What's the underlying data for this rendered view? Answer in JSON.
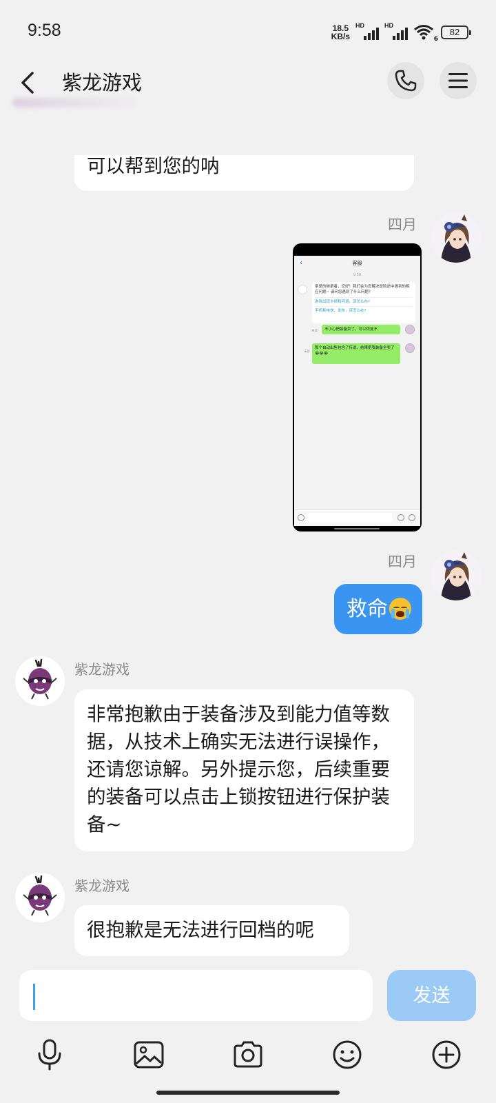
{
  "status": {
    "time": "9:58",
    "net_speed_value": "18.5",
    "net_speed_unit": "KB/s",
    "sim1_label": "HD",
    "sim2_label": "HD",
    "wifi_label": "6",
    "battery": "82"
  },
  "header": {
    "title": "紫龙游戏"
  },
  "messages": {
    "top_partial": "可以帮到您的呐",
    "time_1": "四月",
    "time_2": "四月",
    "user_text": "救命",
    "sender_1": "紫龙游戏",
    "reply_1": "非常抱歉由于装备涉及到能力值等数据，从技术上确实无法进行误操作，还请您谅解。另外提示您，后续重要的装备可以点击上锁按钮进行保护装备~",
    "sender_2": "紫龙游戏",
    "reply_2": "很抱歉是无法进行回档的呢"
  },
  "screenshot": {
    "nav_title": "客服",
    "time": "9:50",
    "bot_greeting": "亲爱的继承者，您好！我们会为您解决冒险途中遇到的相应问题~ 请问您遇到了什么问题？",
    "faq_1": "游戏出现卡顿和闪退，该怎么办?",
    "faq_2": "手机耗电快，发热，该怎么办?",
    "user_msg_1": "不小心把装备卖了，可以恢复不",
    "user_msg_2": "那个自动出售包含了传说，结果把我装备全卖了😭😭😭",
    "sent_label_1": "未读",
    "sent_label_2": "未读"
  },
  "input": {
    "value": "",
    "send_label": "发送"
  },
  "toolbar": {
    "icons": [
      "mic-icon",
      "image-icon",
      "camera-icon",
      "emoji-icon",
      "plus-icon"
    ]
  },
  "colors": {
    "accent_blue": "#3a94f2",
    "send_disabled": "#9ccaf7",
    "background": "#f1f1f1"
  }
}
